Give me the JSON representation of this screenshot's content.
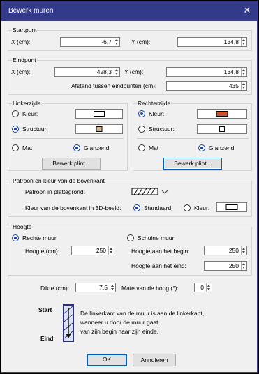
{
  "window": {
    "title": "Bewerk muren",
    "close_icon": "close-icon"
  },
  "startpunt": {
    "label": "Startpunt",
    "x_label": "X (cm):",
    "x_value": "-6,7",
    "y_label": "Y (cm):",
    "y_value": "134,8"
  },
  "eindpunt": {
    "label": "Eindpunt",
    "x_label": "X (cm):",
    "x_value": "428,3",
    "y_label": "Y (cm):",
    "y_value": "134,8",
    "distance_label": "Afstand tussen eindpunten (cm):",
    "distance_value": "435"
  },
  "links": {
    "label": "Linkerzijde",
    "color_label": "Kleur:",
    "texture_label": "Structuur:",
    "matt_label": "Mat",
    "gloss_label": "Glanzend",
    "button": "Bewerk plint...",
    "color_swatch": "#ffffff",
    "texture_swatch": "#d2b48c"
  },
  "rechts": {
    "label": "Rechterzijde",
    "color_label": "Kleur:",
    "texture_label": "Structuur:",
    "matt_label": "Mat",
    "gloss_label": "Glanzend",
    "button": "Bewerk plint...",
    "color_swatch": "#d0522a",
    "texture_swatch": "#ffffff"
  },
  "patroon": {
    "label": "Patroon en kleur van de bovenkant",
    "pattern_label": "Patroon in plattegrond:",
    "top_color_label": "Kleur van de bovenkant in 3D-beeld:",
    "standard_label": "Standaard",
    "color_label": "Kleur:",
    "top_swatch": "#ffffff"
  },
  "hoogte": {
    "label": "Hoogte",
    "straight_label": "Rechte muur",
    "sloped_label": "Schuine muur",
    "height_label": "Hoogte (cm):",
    "height_value": "250",
    "start_label": "Hoogte aan het begin:",
    "start_value": "250",
    "end_label": "Hoogte aan het eind:",
    "end_value": "250"
  },
  "dikte": {
    "label": "Dikte (cm):",
    "value": "7,5",
    "arc_label": "Mate van de boog (°):",
    "arc_value": "0"
  },
  "info": {
    "start": "Start",
    "end": "Eind",
    "line1": "De linkerkant van de muur is aan de linkerkant,",
    "line2": "wanneer u door de muur gaat",
    "line3": "van zijn begin naar zijn einde."
  },
  "buttons": {
    "ok": "OK",
    "cancel": "Annuleren"
  }
}
